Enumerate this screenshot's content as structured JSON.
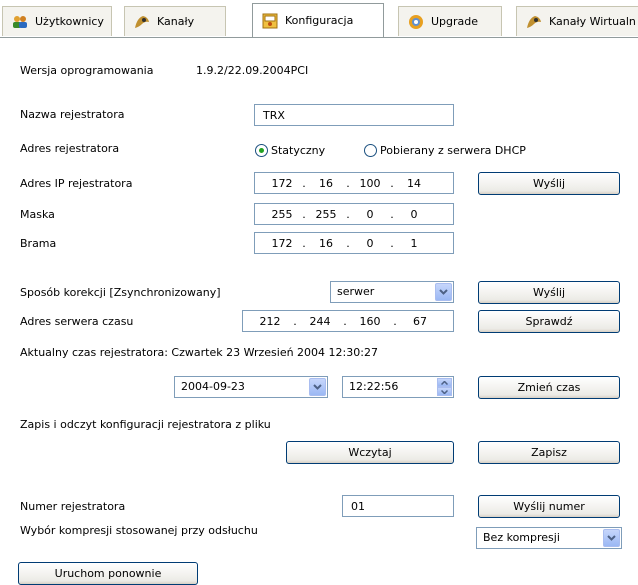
{
  "tabs": [
    {
      "label": "Użytkownicy",
      "icon": "users-icon"
    },
    {
      "label": "Kanały",
      "icon": "channels-icon"
    },
    {
      "label": "Konfiguracja",
      "icon": "config-icon",
      "active": true
    },
    {
      "label": "Upgrade",
      "icon": "upgrade-icon"
    },
    {
      "label": "Kanały Wirtualn",
      "icon": "virtual-channels-icon"
    }
  ],
  "firmware": {
    "label": "Wersja oprogramowania",
    "value": "1.9.2/22.09.2004PCI"
  },
  "recorder_name": {
    "label": "Nazwa rejestratora",
    "value": "TRX"
  },
  "address": {
    "label": "Adres rejestratora",
    "static_label": "Statyczny",
    "dhcp_label": "Pobierany z serwera DHCP",
    "selected": "static"
  },
  "ip": {
    "label": "Adres IP rejestratora",
    "octets": [
      "172",
      "16",
      "100",
      "14"
    ],
    "send_label": "Wyślij"
  },
  "mask": {
    "label": "Maska",
    "octets": [
      "255",
      "255",
      "0",
      "0"
    ]
  },
  "gateway": {
    "label": "Brama",
    "octets": [
      "172",
      "16",
      "0",
      "1"
    ]
  },
  "correction": {
    "label": "Sposób korekcji [Zsynchronizowany]",
    "value": "serwer",
    "send_label": "Wyślij"
  },
  "time_server": {
    "label": "Adres serwera czasu",
    "octets": [
      "212",
      "244",
      "160",
      "67"
    ],
    "check_label": "Sprawdź"
  },
  "current_time": {
    "text": "Aktualny czas rejestratora: Czwartek 23 Wrzesień 2004 12:30:27"
  },
  "set_time": {
    "date": "2004-09-23",
    "time": "12:22:56",
    "button_label": "Zmień czas"
  },
  "config_file": {
    "label": "Zapis i odczyt konfiguracji rejestratora z pliku",
    "load_label": "Wczytaj",
    "save_label": "Zapisz"
  },
  "recorder_number": {
    "label": "Numer rejestratora",
    "value": "01",
    "send_label": "Wyślij numer"
  },
  "compression": {
    "label": "Wybór kompresji stosowanej przy odsłuchu",
    "value": "Bez kompresji"
  },
  "restart": {
    "label": "Uruchom ponownie"
  }
}
